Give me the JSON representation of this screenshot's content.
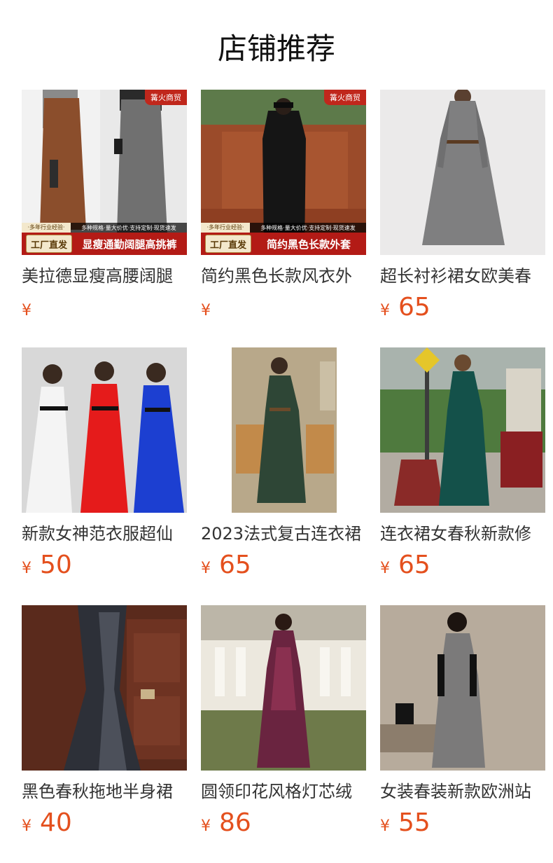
{
  "header": {
    "title": "店铺推荐"
  },
  "products": [
    {
      "name": "美拉德显瘦高腰阔腿",
      "currency": "¥",
      "price": "",
      "badge": "篝火商贸",
      "promo": {
        "left_top": "·多年行业经验·",
        "left": "工厂直发",
        "right_top": "多种规格·量大价优·支持定制·现货速发",
        "right": "显瘦通勤阔腿高挑裤"
      }
    },
    {
      "name": "简约黑色长款风衣外",
      "currency": "¥",
      "price": "",
      "badge": "篝火商贸",
      "promo": {
        "left_top": "·多年行业经验·",
        "left": "工厂直发",
        "right_top": "多种规格·量大价优·支持定制·现货速发",
        "right": "简约黑色长款外套"
      }
    },
    {
      "name": "超长衬衫裙女欧美春",
      "currency": "¥",
      "price": "65"
    },
    {
      "name": "新款女神范衣服超仙",
      "currency": "¥",
      "price": "50"
    },
    {
      "name": "2023法式复古连衣裙",
      "currency": "¥",
      "price": "65"
    },
    {
      "name": "连衣裙女春秋新款修",
      "currency": "¥",
      "price": "65"
    },
    {
      "name": "黑色春秋拖地半身裙",
      "currency": "¥",
      "price": "40"
    },
    {
      "name": "圆领印花风格灯芯绒",
      "currency": "¥",
      "price": "86"
    },
    {
      "name": "女装春装新款欧洲站",
      "currency": "¥",
      "price": "55"
    }
  ],
  "colors": {
    "price": "#e4501e",
    "title": "#111111",
    "name": "#333333",
    "promo_bar": "#b31b16"
  }
}
